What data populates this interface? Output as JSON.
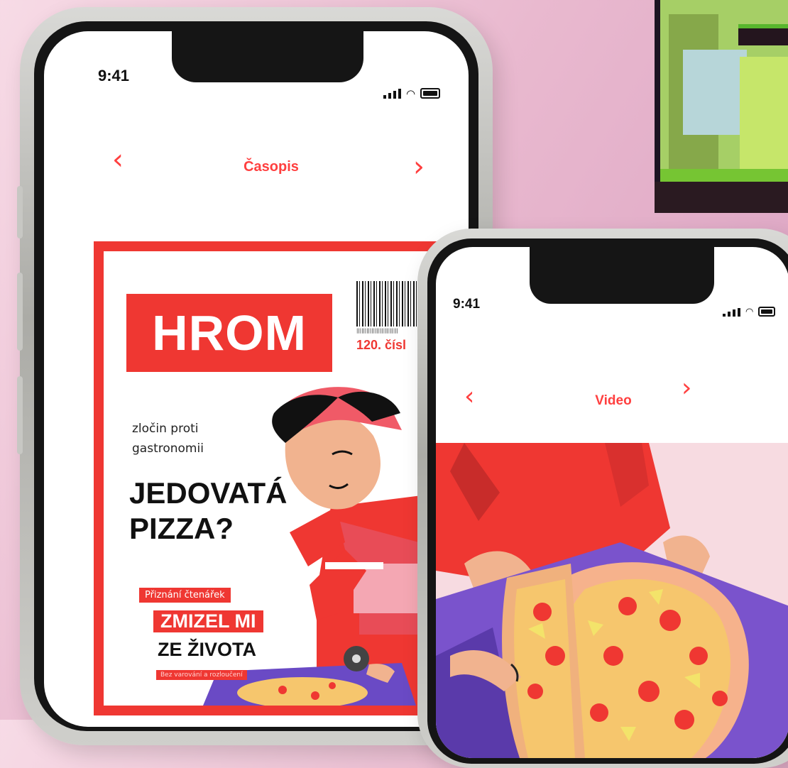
{
  "phone_left": {
    "status_time": "9:41",
    "nav": {
      "title": "Časopis",
      "prev_icon": "chevron-left-icon",
      "next_icon": "chevron-right-icon"
    },
    "magazine_cover": {
      "logo": "HROM",
      "issue": "120. čísl",
      "tagline": "zločin proti gastronomii",
      "headline_line1": "JEDOVATÁ",
      "headline_line2": "PIZZA?",
      "reader_tag": "Přiznání čtenářek",
      "story_line1": "ZMIZEL MI",
      "story_line2": "ZE ŽIVOTA",
      "story_sub": "Bez varování a rozloučení"
    }
  },
  "phone_right": {
    "status_time": "9:41",
    "nav": {
      "title": "Video",
      "prev_icon": "chevron-left-icon",
      "next_icon": "chevron-right-icon"
    },
    "video": {
      "content": "pizza-delivery-illustration"
    }
  },
  "thumbnail": {
    "content": "pixel-art-game-scene"
  },
  "colors": {
    "accent": "#ef3732",
    "nav_text": "#ff3f3f",
    "background": "#e9b9cf"
  }
}
